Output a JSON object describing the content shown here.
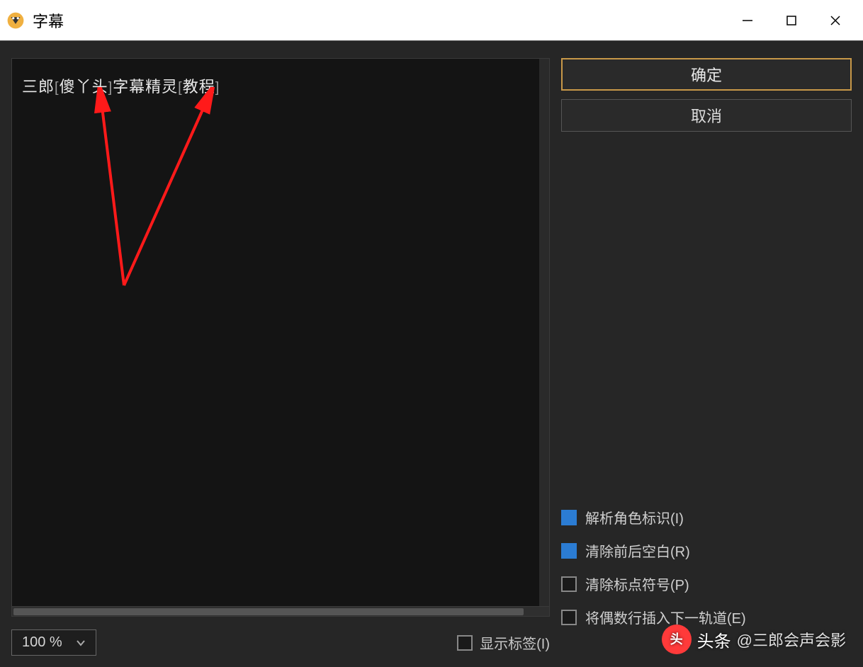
{
  "window": {
    "title": "字幕"
  },
  "editor": {
    "text": "三郎[傻丫头]字幕精灵[教程]",
    "zoom": "100 %"
  },
  "buttons": {
    "ok": "确定",
    "cancel": "取消"
  },
  "options": {
    "parseRoleTag": {
      "label": "解析角色标识(I)",
      "checked": true
    },
    "trimSpaces": {
      "label": "清除前后空白(R)",
      "checked": true
    },
    "removePunct": {
      "label": "清除标点符号(P)",
      "checked": false
    },
    "evenLinesNextTrack": {
      "label": "将偶数行插入下一轨道(E)",
      "checked": false
    },
    "showTags": {
      "label": "显示标签(I)",
      "checked": false
    }
  },
  "watermark": {
    "brand": "头条",
    "handle": "@三郎会声会影"
  }
}
